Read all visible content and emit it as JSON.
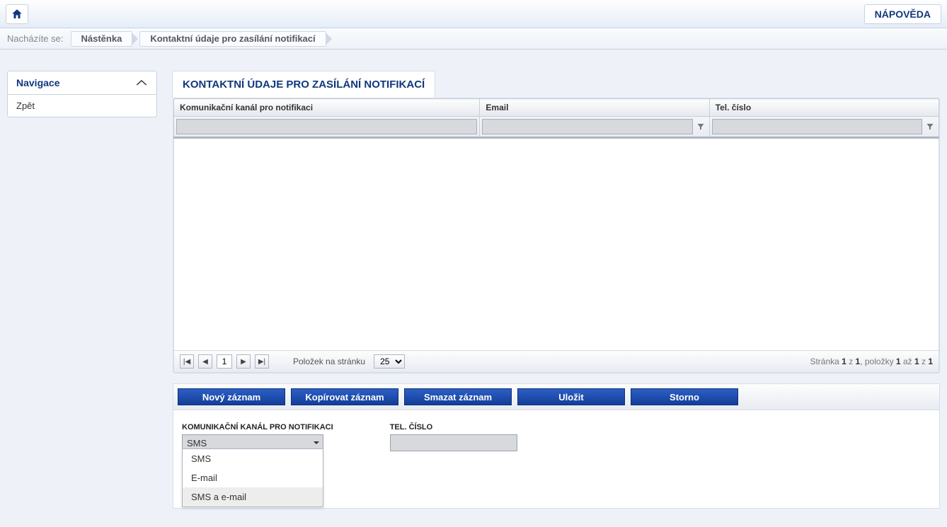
{
  "topbar": {
    "help_label": "NÁPOVĚDA"
  },
  "breadcrumb": {
    "label": "Nacházíte se:",
    "items": [
      "Nástěnka",
      "Kontaktní údaje pro zasílání notifikací"
    ]
  },
  "sidebar": {
    "title": "Navigace",
    "items": [
      "Zpět"
    ]
  },
  "panel": {
    "title": "KONTAKTNÍ ÚDAJE PRO ZASÍLÁNÍ NOTIFIKACÍ"
  },
  "table": {
    "columns": [
      "Komunikační kanál pro notifikaci",
      "Email",
      "Tel. číslo"
    ]
  },
  "pager": {
    "first": "|◀",
    "prev": "◀",
    "page_value": "1",
    "next": "▶",
    "last": "▶|",
    "per_page_label": "Položek na stránku",
    "per_page_value": "25",
    "status_prefix": "Stránka ",
    "status_page": "1",
    "status_of": " z ",
    "status_total": "1",
    "status_items_prefix": ", položky ",
    "status_from": "1",
    "status_to_label": " až ",
    "status_to": "1",
    "status_of2": " z ",
    "status_items_total": "1"
  },
  "actions": {
    "new": "Nový záznam",
    "copy": "Kopírovat záznam",
    "delete": "Smazat záznam",
    "save": "Uložit",
    "cancel": "Storno"
  },
  "form": {
    "channel_label": "KOMUNIKAČNÍ KANÁL PRO NOTIFIKACI",
    "channel_value": "SMS",
    "tel_label": "TEL. ČÍSLO",
    "tel_value": "",
    "dropdown_options": [
      "SMS",
      "E-mail",
      "SMS a e-mail"
    ]
  }
}
